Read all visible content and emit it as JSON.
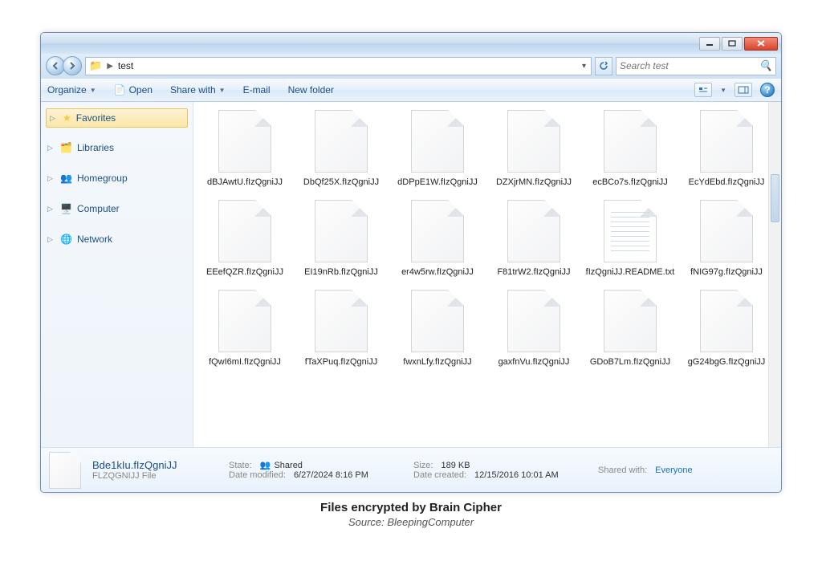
{
  "breadcrumb": {
    "folder": "test"
  },
  "search": {
    "placeholder": "Search test"
  },
  "toolbar": {
    "organize": "Organize",
    "open": "Open",
    "share": "Share with",
    "email": "E-mail",
    "newfolder": "New folder"
  },
  "sidebar": {
    "favorites": "Favorites",
    "libraries": "Libraries",
    "homegroup": "Homegroup",
    "computer": "Computer",
    "network": "Network"
  },
  "files": [
    {
      "name": "dBJAwtU.fIzQgniJJ",
      "type": "blank"
    },
    {
      "name": "DbQf25X.fIzQgniJJ",
      "type": "blank"
    },
    {
      "name": "dDPpE1W.fIzQgniJJ",
      "type": "blank"
    },
    {
      "name": "DZXjrMN.fIzQgniJJ",
      "type": "blank"
    },
    {
      "name": "ecBCo7s.fIzQgniJJ",
      "type": "blank"
    },
    {
      "name": "EcYdEbd.fIzQgniJJ",
      "type": "blank"
    },
    {
      "name": "EEefQZR.fIzQgniJJ",
      "type": "blank"
    },
    {
      "name": "EI19nRb.fIzQgniJJ",
      "type": "blank"
    },
    {
      "name": "er4w5rw.fIzQgniJJ",
      "type": "blank"
    },
    {
      "name": "F81trW2.fIzQgniJJ",
      "type": "blank"
    },
    {
      "name": "fIzQgniJJ.README.txt",
      "type": "txt"
    },
    {
      "name": "fNIG97g.fIzQgniJJ",
      "type": "blank"
    },
    {
      "name": "fQwI6mI.fIzQgniJJ",
      "type": "blank"
    },
    {
      "name": "fTaXPuq.fIzQgniJJ",
      "type": "blank"
    },
    {
      "name": "fwxnLfy.fIzQgniJJ",
      "type": "blank"
    },
    {
      "name": "gaxfnVu.fIzQgniJJ",
      "type": "blank"
    },
    {
      "name": "GDoB7Lm.fIzQgniJJ",
      "type": "blank"
    },
    {
      "name": "gG24bgG.fIzQgniJJ",
      "type": "blank"
    }
  ],
  "details": {
    "selected_name": "Bde1kIu.fIzQgniJJ",
    "type_label": "FLZQGNIJJ File",
    "state_label": "State:",
    "state_value": "Shared",
    "modified_label": "Date modified:",
    "modified_value": "6/27/2024 8:16 PM",
    "size_label": "Size:",
    "size_value": "189 KB",
    "created_label": "Date created:",
    "created_value": "12/15/2016 10:01 AM",
    "shared_label": "Shared with:",
    "shared_value": "Everyone"
  },
  "caption": {
    "line1": "Files encrypted by Brain Cipher",
    "line2": "Source: BleepingComputer"
  }
}
